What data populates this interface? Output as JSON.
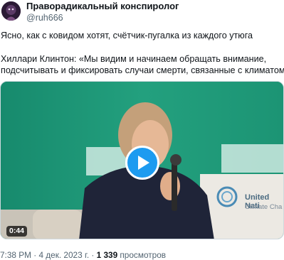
{
  "author": {
    "display_name": "Праворадикальный конспиролог",
    "handle": "@ruh666"
  },
  "tweet": {
    "line1": "Ясно, как с ковидом хотят, счётчик-пугалка из каждого утюга",
    "line2": "Хиллари Клинтон: «Мы видим и начинаем обращать внимание,",
    "line3": "подсчитывать и фиксировать случаи смерти, связанные с климатом»."
  },
  "media": {
    "duration": "0:44",
    "banner_text_1": "United Nati",
    "banner_text_2": "Climate Cha"
  },
  "meta": {
    "time": "7:38 PM",
    "separator": "·",
    "date": "4 дек. 2023 г.",
    "views_count": "1 339",
    "views_label": "просмотров"
  },
  "colors": {
    "accent": "#1d9bf0",
    "stage_green": "#1f8f74",
    "text_primary": "#0f1419",
    "text_secondary": "#536471"
  },
  "icons": {
    "play": "play-icon",
    "un_climate": "un-climate-logo"
  }
}
